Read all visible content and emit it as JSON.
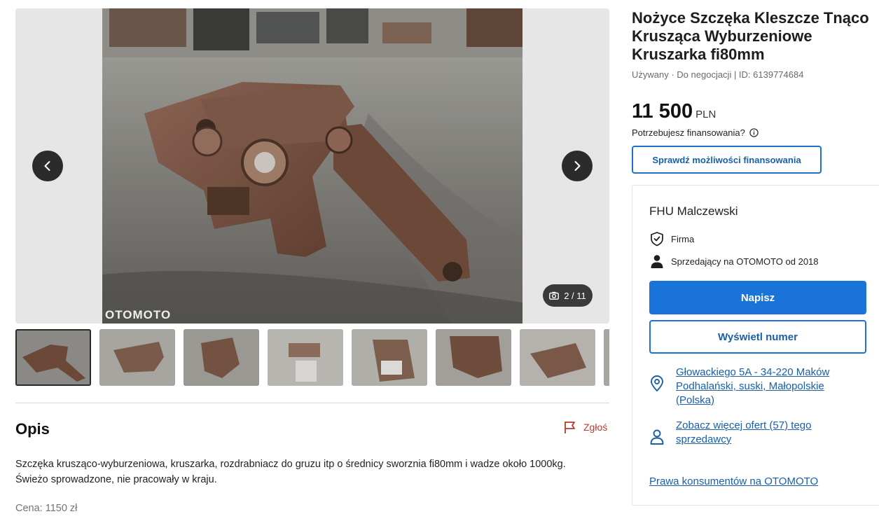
{
  "listing": {
    "title": "Nożyce Szczęka Kleszcze Tnąco Krusząca Wyburzeniowe Kruszarka fi80mm",
    "meta": "Używany · Do negocjacji | ID: 6139774684",
    "price_value": "11 500",
    "price_currency": "PLN",
    "finance_question": "Potrzebujesz finansowania?",
    "finance_button": "Sprawdź możliwości finansowania"
  },
  "gallery": {
    "watermark": "OTOMOTO",
    "counter": "2 / 11",
    "thumbnail_count": 8,
    "active_thumbnail": 1
  },
  "description": {
    "heading": "Opis",
    "report_label": "Zgłoś",
    "text": "Szczęka kruszącо-wyburzeniowa, kruszarka, rozdrabniacz do gruzu itp o średnicy sworznia fi80mm i wadze około 1000kg. Świeżo sprowadzone, nie pracowały w kraju.",
    "extra": "Cena: 1150 zł"
  },
  "seller": {
    "name": "FHU Malczewski",
    "type": "Firma",
    "since": "Sprzedający na OTOMOTO od 2018",
    "write_button": "Napisz",
    "phone_button": "Wyświetl numer",
    "location": "Głowackiego 5A - 34-220 Maków Podhalański, suski, Małopolskie (Polska)",
    "more_offers": "Zobacz więcej ofert (57) tego sprzedawcy",
    "consumer_rights": "Prawa konsumentów na OTOMOTO"
  },
  "colors": {
    "accent_blue": "#1a73d9",
    "link_blue": "#1a5fa8",
    "report_red": "#c0392b"
  },
  "icons": {
    "prev": "chevron-left-icon",
    "next": "chevron-right-icon",
    "camera": "camera-icon",
    "flag": "flag-icon",
    "info": "info-icon",
    "shield": "shield-check-icon",
    "person": "person-icon",
    "pin": "map-pin-icon",
    "user_outline": "user-outline-icon"
  }
}
